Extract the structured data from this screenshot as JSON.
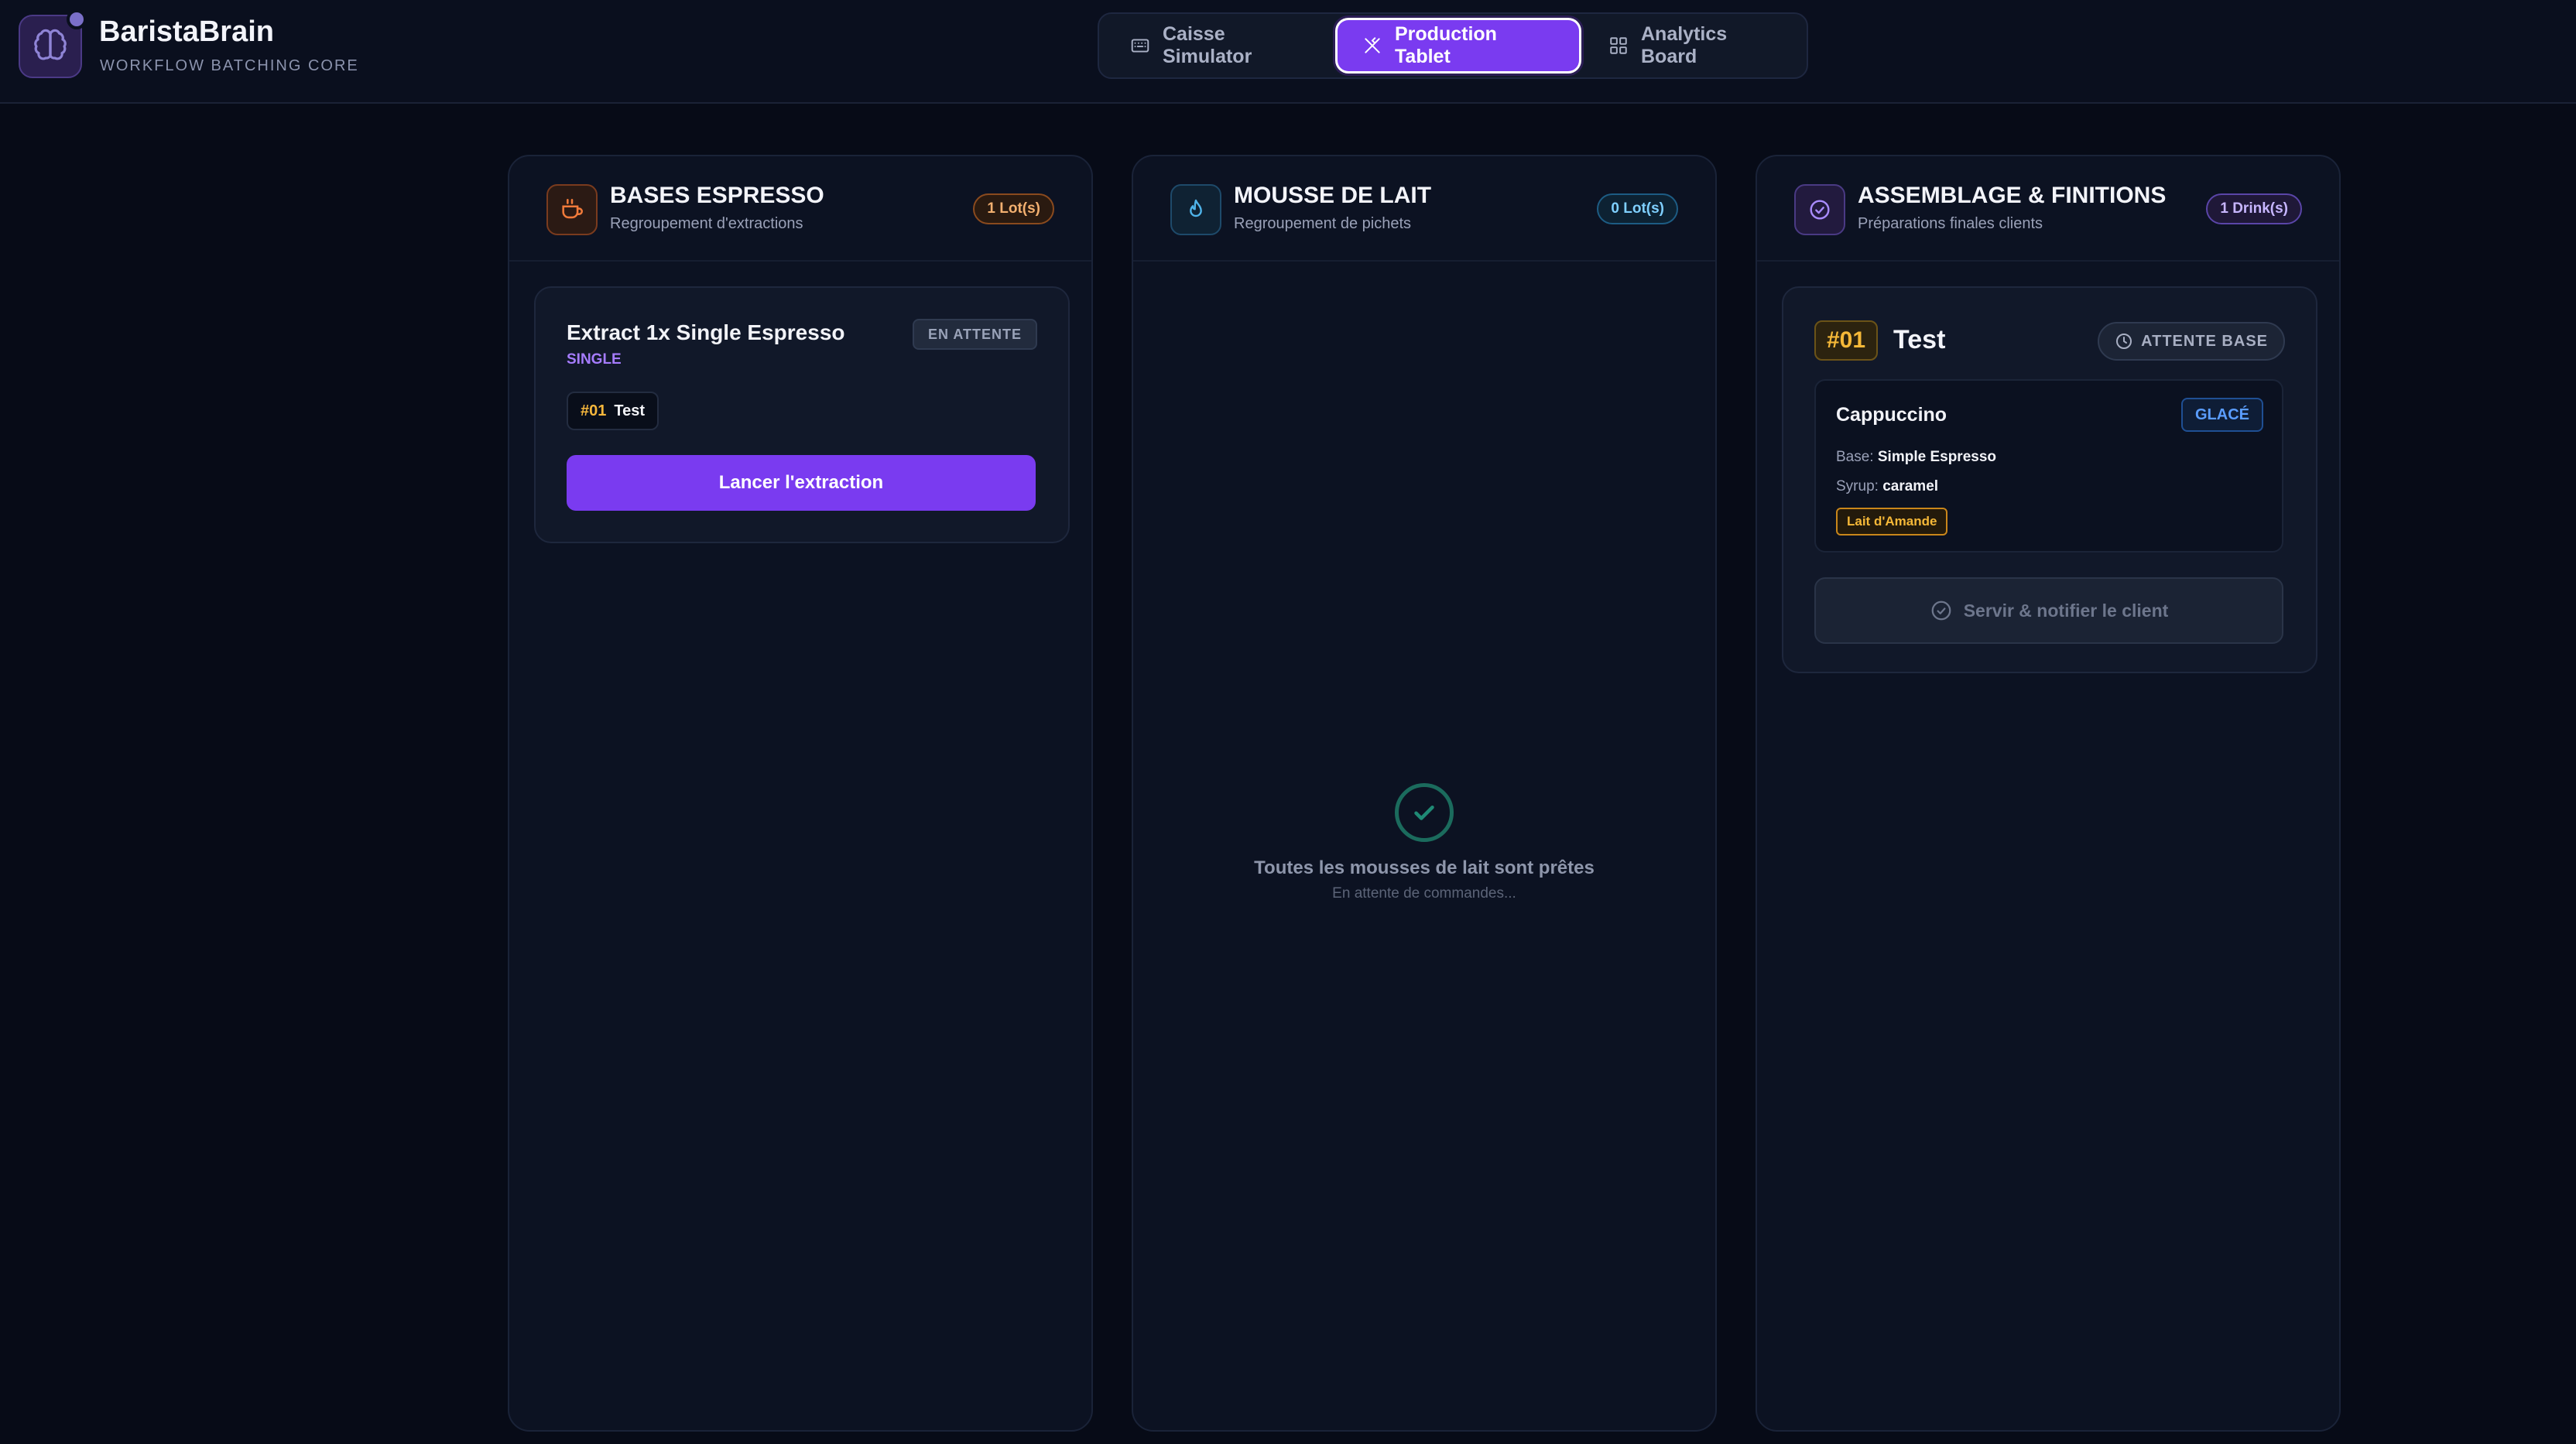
{
  "app": {
    "name": "BaristaBrain",
    "subtitle": "WORKFLOW BATCHING CORE",
    "logo_icon": "brain-icon"
  },
  "nav": {
    "tabs": [
      {
        "label": "Caisse Simulator",
        "icon": "keyboard-icon",
        "active": false
      },
      {
        "label": "Production Tablet",
        "icon": "utensils-icon",
        "active": true
      },
      {
        "label": "Analytics Board",
        "icon": "grid-icon",
        "active": false
      }
    ]
  },
  "columns": {
    "espresso": {
      "title": "BASES ESPRESSO",
      "subtitle": "Regroupement d'extractions",
      "count": "1 Lot(s)",
      "icon": "coffee-icon",
      "card": {
        "title": "Extract 1x Single Espresso",
        "type": "SINGLE",
        "status": "EN ATTENTE",
        "order_num": "#01",
        "order_name": "Test",
        "action": "Lancer l'extraction"
      }
    },
    "milk": {
      "title": "MOUSSE DE LAIT",
      "subtitle": "Regroupement de pichets",
      "count": "0 Lot(s)",
      "icon": "flame-icon",
      "empty_title": "Toutes les mousses de lait sont prêtes",
      "empty_sub": "En attente de commandes..."
    },
    "assembly": {
      "title": "ASSEMBLAGE & FINITIONS",
      "subtitle": "Préparations finales clients",
      "count": "1 Drink(s)",
      "icon": "check-circle-icon",
      "order": {
        "num": "#01",
        "name": "Test",
        "status": "ATTENTE BASE",
        "drink": {
          "name": "Cappuccino",
          "temp": "GLACÉ",
          "base_label": "Base:",
          "base_value": "Simple Espresso",
          "syrup_label": "Syrup:",
          "syrup_value": "caramel",
          "milk": "Lait d'Amande"
        },
        "action": "Servir & notifier le client"
      }
    }
  },
  "colors": {
    "accent": "#7a3bf0",
    "background": "#070b17",
    "order_gold": "#f5b838"
  }
}
